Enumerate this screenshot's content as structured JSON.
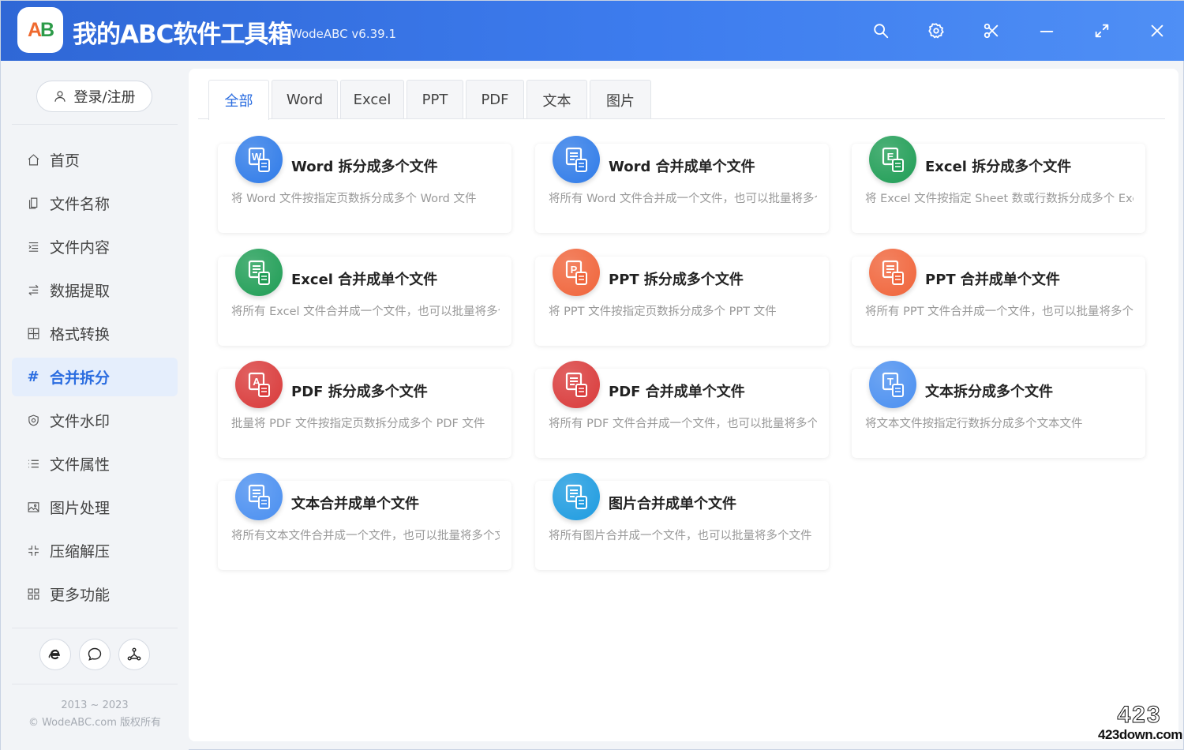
{
  "window": {
    "title": "我的ABC软件工具箱",
    "version": "WodeABC v6.39.1",
    "logo_text_a": "A",
    "logo_text_b": "B",
    "controls": [
      "search-icon",
      "settings-icon",
      "scissors-icon",
      "minimize-icon",
      "maximize-icon",
      "close-icon"
    ]
  },
  "sidebar": {
    "login_label": "登录/注册",
    "items": [
      {
        "label": "首页",
        "icon": "home-icon"
      },
      {
        "label": "文件名称",
        "icon": "file-name-icon"
      },
      {
        "label": "文件内容",
        "icon": "file-content-icon"
      },
      {
        "label": "数据提取",
        "icon": "data-extract-icon"
      },
      {
        "label": "格式转换",
        "icon": "format-convert-icon"
      },
      {
        "label": "合并拆分",
        "icon": "hash-icon",
        "active": true
      },
      {
        "label": "文件水印",
        "icon": "watermark-shield-icon"
      },
      {
        "label": "文件属性",
        "icon": "list-icon"
      },
      {
        "label": "图片处理",
        "icon": "image-icon"
      },
      {
        "label": "压缩解压",
        "icon": "compress-icon"
      },
      {
        "label": "更多功能",
        "icon": "grid-icon"
      }
    ],
    "bottom_buttons": [
      "browser-e-icon",
      "chat-bubble-icon",
      "share-network-icon"
    ],
    "copyright_years": "2013 ~ 2023",
    "copyright_text": "© WodeABC.com 版权所有"
  },
  "tabs": [
    {
      "label": "全部",
      "active": true
    },
    {
      "label": "Word"
    },
    {
      "label": "Excel"
    },
    {
      "label": "PPT"
    },
    {
      "label": "PDF"
    },
    {
      "label": "文本"
    },
    {
      "label": "图片"
    }
  ],
  "cards": [
    {
      "title": "Word 拆分成多个文件",
      "desc": "将 Word 文件按指定页数拆分成多个 Word 文件",
      "icon": "word-split-icon",
      "color": "#2f7be8",
      "letter": "W"
    },
    {
      "title": "Word 合并成单个文件",
      "desc": "将所有 Word 文件合并成一个文件，也可以批量将多个文件",
      "icon": "word-merge-icon",
      "color": "#2f7be8",
      "letter": ""
    },
    {
      "title": "Excel 拆分成多个文件",
      "desc": "将 Excel 文件按指定 Sheet 数或行数拆分成多个 Excel 文件",
      "icon": "excel-split-icon",
      "color": "#1f9d55",
      "letter": "E"
    },
    {
      "title": "Excel 合并成单个文件",
      "desc": "将所有 Excel 文件合并成一个文件，也可以批量将多个文件",
      "icon": "excel-merge-icon",
      "color": "#1f9d55",
      "letter": ""
    },
    {
      "title": "PPT 拆分成多个文件",
      "desc": "将 PPT 文件按指定页数拆分成多个 PPT 文件",
      "icon": "ppt-split-icon",
      "color": "#f0643a",
      "letter": "P"
    },
    {
      "title": "PPT 合并成单个文件",
      "desc": "将所有 PPT 文件合并成一个文件，也可以批量将多个文件",
      "icon": "ppt-merge-icon",
      "color": "#f0643a",
      "letter": ""
    },
    {
      "title": "PDF 拆分成多个文件",
      "desc": "批量将 PDF 文件按指定页数拆分成多个 PDF 文件",
      "icon": "pdf-split-icon",
      "color": "#d93a3a",
      "letter": "A"
    },
    {
      "title": "PDF 合并成单个文件",
      "desc": "将所有 PDF 文件合并成一个文件，也可以批量将多个文件",
      "icon": "pdf-merge-icon",
      "color": "#d93a3a",
      "letter": ""
    },
    {
      "title": "文本拆分成多个文件",
      "desc": "将文本文件按指定行数拆分成多个文本文件",
      "icon": "text-split-icon",
      "color": "#4a8ff0",
      "letter": "T"
    },
    {
      "title": "文本合并成单个文件",
      "desc": "将所有文本文件合并成一个文件，也可以批量将多个文件",
      "icon": "text-merge-icon",
      "color": "#4a8ff0",
      "letter": ""
    },
    {
      "title": "图片合并成单个文件",
      "desc": "将所有图片合并成一个文件，也可以批量将多个文件",
      "icon": "image-merge-icon",
      "color": "#1d9be0",
      "letter": ""
    }
  ],
  "watermark": {
    "line1": "423",
    "line2": "423down.com"
  }
}
